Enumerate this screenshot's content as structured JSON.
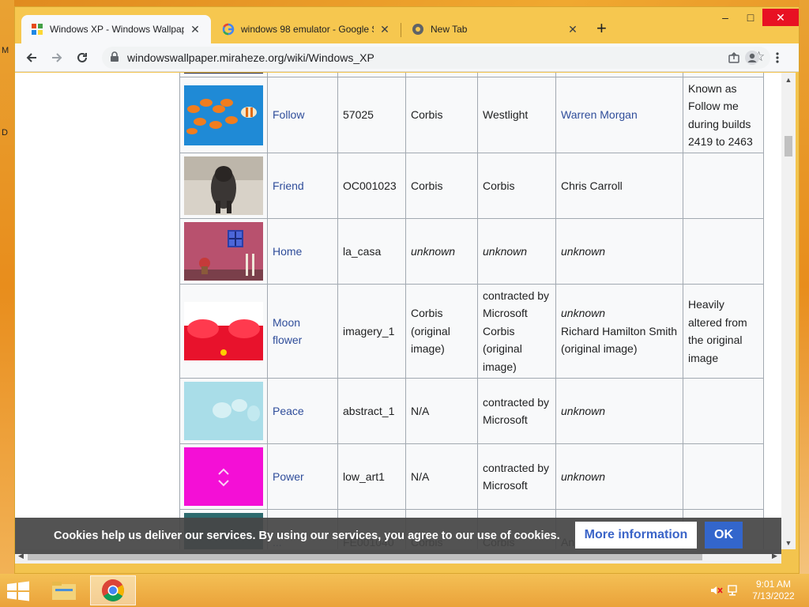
{
  "desktop": {
    "edge_letters": [
      "M",
      "D"
    ]
  },
  "tabs": [
    {
      "title": "Windows XP - Windows Wallpap",
      "active": true,
      "favicon": "wiki-favicon"
    },
    {
      "title": "windows 98 emulator - Google S",
      "active": false,
      "favicon": "google-favicon"
    },
    {
      "title": "New Tab",
      "active": false,
      "favicon": "chrome-favicon"
    }
  ],
  "window_controls": {
    "minimize": "–",
    "maximize": "□",
    "close": "✕"
  },
  "address": {
    "url": "windowswallpaper.miraheze.org/wiki/Windows_XP"
  },
  "table": {
    "rows": [
      {
        "name": "Follow",
        "file": "57025",
        "agency": "Corbis",
        "source": "Westlight",
        "author": "Warren Morgan",
        "author_link": true,
        "author_italic": false,
        "notes": [
          "Known as",
          "Follow me",
          "during builds",
          "2419 to 2463"
        ],
        "thumb": "fish"
      },
      {
        "name": "Friend",
        "file": "OC001023",
        "agency": "Corbis",
        "source": "Corbis",
        "author": "Chris Carroll",
        "author_link": false,
        "author_italic": false,
        "notes": [],
        "thumb": "dog"
      },
      {
        "name": "Home",
        "file": "la_casa",
        "agency": "unknown",
        "agency_italic": true,
        "source": "unknown",
        "source_italic": true,
        "author": "unknown",
        "author_link": false,
        "author_italic": true,
        "notes": [],
        "thumb": "house"
      },
      {
        "name": "Moon flower",
        "file": "imagery_1",
        "agency_lines": [
          "Corbis",
          "(original",
          "image)"
        ],
        "source_lines": [
          "contracted by",
          "Microsoft",
          "Corbis",
          "(original",
          "image)"
        ],
        "author_lines": [
          "unknown",
          "Richard Hamilton Smith",
          "(original image)"
        ],
        "notes": [
          "Heavily",
          "altered from",
          "the original",
          "image"
        ],
        "thumb": "flower"
      },
      {
        "name": "Peace",
        "file": "abstract_1",
        "agency": "N/A",
        "source_lines": [
          "contracted by",
          "Microsoft"
        ],
        "author": "unknown",
        "author_italic": true,
        "notes": [],
        "thumb": "peace"
      },
      {
        "name": "Power",
        "file": "low_art1",
        "agency": "N/A",
        "source_lines": [
          "contracted by",
          "Microsoft"
        ],
        "author": "unknown",
        "author_italic": true,
        "notes": [],
        "thumb": "power"
      }
    ],
    "partial_row": {
      "name": "...",
      "file": "FE001040",
      "agency": "Corbis",
      "source": "Corbis",
      "author": "An"
    }
  },
  "cookie_bar": {
    "message": "Cookies help us deliver our services. By using our services, you agree to our use of cookies.",
    "more_label": "More information",
    "ok_label": "OK"
  },
  "taskbar": {
    "apps": [
      "file-explorer-icon",
      "chrome-icon"
    ],
    "time": "9:01 AM",
    "date": "7/13/2022"
  }
}
